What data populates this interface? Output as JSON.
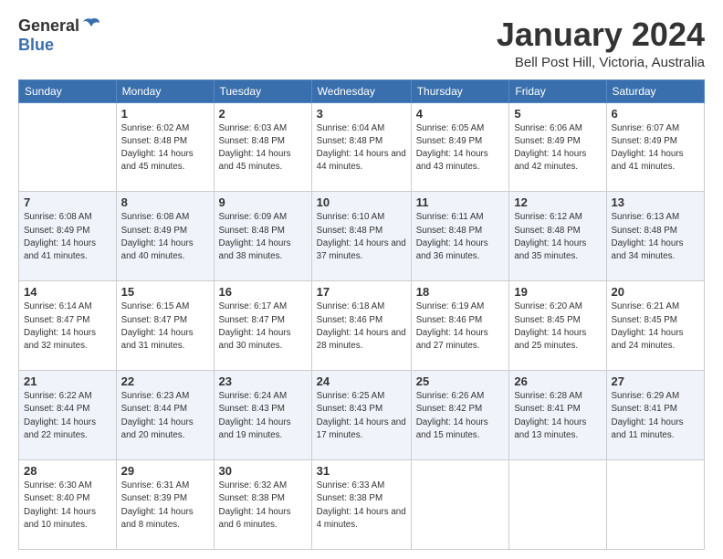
{
  "header": {
    "logo_general": "General",
    "logo_blue": "Blue",
    "title": "January 2024",
    "location": "Bell Post Hill, Victoria, Australia"
  },
  "weekdays": [
    "Sunday",
    "Monday",
    "Tuesday",
    "Wednesday",
    "Thursday",
    "Friday",
    "Saturday"
  ],
  "weeks": [
    [
      {
        "day": "",
        "sunrise": "",
        "sunset": "",
        "daylight": ""
      },
      {
        "day": "1",
        "sunrise": "Sunrise: 6:02 AM",
        "sunset": "Sunset: 8:48 PM",
        "daylight": "Daylight: 14 hours and 45 minutes."
      },
      {
        "day": "2",
        "sunrise": "Sunrise: 6:03 AM",
        "sunset": "Sunset: 8:48 PM",
        "daylight": "Daylight: 14 hours and 45 minutes."
      },
      {
        "day": "3",
        "sunrise": "Sunrise: 6:04 AM",
        "sunset": "Sunset: 8:48 PM",
        "daylight": "Daylight: 14 hours and 44 minutes."
      },
      {
        "day": "4",
        "sunrise": "Sunrise: 6:05 AM",
        "sunset": "Sunset: 8:49 PM",
        "daylight": "Daylight: 14 hours and 43 minutes."
      },
      {
        "day": "5",
        "sunrise": "Sunrise: 6:06 AM",
        "sunset": "Sunset: 8:49 PM",
        "daylight": "Daylight: 14 hours and 42 minutes."
      },
      {
        "day": "6",
        "sunrise": "Sunrise: 6:07 AM",
        "sunset": "Sunset: 8:49 PM",
        "daylight": "Daylight: 14 hours and 41 minutes."
      }
    ],
    [
      {
        "day": "7",
        "sunrise": "Sunrise: 6:08 AM",
        "sunset": "Sunset: 8:49 PM",
        "daylight": "Daylight: 14 hours and 41 minutes."
      },
      {
        "day": "8",
        "sunrise": "Sunrise: 6:08 AM",
        "sunset": "Sunset: 8:49 PM",
        "daylight": "Daylight: 14 hours and 40 minutes."
      },
      {
        "day": "9",
        "sunrise": "Sunrise: 6:09 AM",
        "sunset": "Sunset: 8:48 PM",
        "daylight": "Daylight: 14 hours and 38 minutes."
      },
      {
        "day": "10",
        "sunrise": "Sunrise: 6:10 AM",
        "sunset": "Sunset: 8:48 PM",
        "daylight": "Daylight: 14 hours and 37 minutes."
      },
      {
        "day": "11",
        "sunrise": "Sunrise: 6:11 AM",
        "sunset": "Sunset: 8:48 PM",
        "daylight": "Daylight: 14 hours and 36 minutes."
      },
      {
        "day": "12",
        "sunrise": "Sunrise: 6:12 AM",
        "sunset": "Sunset: 8:48 PM",
        "daylight": "Daylight: 14 hours and 35 minutes."
      },
      {
        "day": "13",
        "sunrise": "Sunrise: 6:13 AM",
        "sunset": "Sunset: 8:48 PM",
        "daylight": "Daylight: 14 hours and 34 minutes."
      }
    ],
    [
      {
        "day": "14",
        "sunrise": "Sunrise: 6:14 AM",
        "sunset": "Sunset: 8:47 PM",
        "daylight": "Daylight: 14 hours and 32 minutes."
      },
      {
        "day": "15",
        "sunrise": "Sunrise: 6:15 AM",
        "sunset": "Sunset: 8:47 PM",
        "daylight": "Daylight: 14 hours and 31 minutes."
      },
      {
        "day": "16",
        "sunrise": "Sunrise: 6:17 AM",
        "sunset": "Sunset: 8:47 PM",
        "daylight": "Daylight: 14 hours and 30 minutes."
      },
      {
        "day": "17",
        "sunrise": "Sunrise: 6:18 AM",
        "sunset": "Sunset: 8:46 PM",
        "daylight": "Daylight: 14 hours and 28 minutes."
      },
      {
        "day": "18",
        "sunrise": "Sunrise: 6:19 AM",
        "sunset": "Sunset: 8:46 PM",
        "daylight": "Daylight: 14 hours and 27 minutes."
      },
      {
        "day": "19",
        "sunrise": "Sunrise: 6:20 AM",
        "sunset": "Sunset: 8:45 PM",
        "daylight": "Daylight: 14 hours and 25 minutes."
      },
      {
        "day": "20",
        "sunrise": "Sunrise: 6:21 AM",
        "sunset": "Sunset: 8:45 PM",
        "daylight": "Daylight: 14 hours and 24 minutes."
      }
    ],
    [
      {
        "day": "21",
        "sunrise": "Sunrise: 6:22 AM",
        "sunset": "Sunset: 8:44 PM",
        "daylight": "Daylight: 14 hours and 22 minutes."
      },
      {
        "day": "22",
        "sunrise": "Sunrise: 6:23 AM",
        "sunset": "Sunset: 8:44 PM",
        "daylight": "Daylight: 14 hours and 20 minutes."
      },
      {
        "day": "23",
        "sunrise": "Sunrise: 6:24 AM",
        "sunset": "Sunset: 8:43 PM",
        "daylight": "Daylight: 14 hours and 19 minutes."
      },
      {
        "day": "24",
        "sunrise": "Sunrise: 6:25 AM",
        "sunset": "Sunset: 8:43 PM",
        "daylight": "Daylight: 14 hours and 17 minutes."
      },
      {
        "day": "25",
        "sunrise": "Sunrise: 6:26 AM",
        "sunset": "Sunset: 8:42 PM",
        "daylight": "Daylight: 14 hours and 15 minutes."
      },
      {
        "day": "26",
        "sunrise": "Sunrise: 6:28 AM",
        "sunset": "Sunset: 8:41 PM",
        "daylight": "Daylight: 14 hours and 13 minutes."
      },
      {
        "day": "27",
        "sunrise": "Sunrise: 6:29 AM",
        "sunset": "Sunset: 8:41 PM",
        "daylight": "Daylight: 14 hours and 11 minutes."
      }
    ],
    [
      {
        "day": "28",
        "sunrise": "Sunrise: 6:30 AM",
        "sunset": "Sunset: 8:40 PM",
        "daylight": "Daylight: 14 hours and 10 minutes."
      },
      {
        "day": "29",
        "sunrise": "Sunrise: 6:31 AM",
        "sunset": "Sunset: 8:39 PM",
        "daylight": "Daylight: 14 hours and 8 minutes."
      },
      {
        "day": "30",
        "sunrise": "Sunrise: 6:32 AM",
        "sunset": "Sunset: 8:38 PM",
        "daylight": "Daylight: 14 hours and 6 minutes."
      },
      {
        "day": "31",
        "sunrise": "Sunrise: 6:33 AM",
        "sunset": "Sunset: 8:38 PM",
        "daylight": "Daylight: 14 hours and 4 minutes."
      },
      {
        "day": "",
        "sunrise": "",
        "sunset": "",
        "daylight": ""
      },
      {
        "day": "",
        "sunrise": "",
        "sunset": "",
        "daylight": ""
      },
      {
        "day": "",
        "sunrise": "",
        "sunset": "",
        "daylight": ""
      }
    ]
  ]
}
